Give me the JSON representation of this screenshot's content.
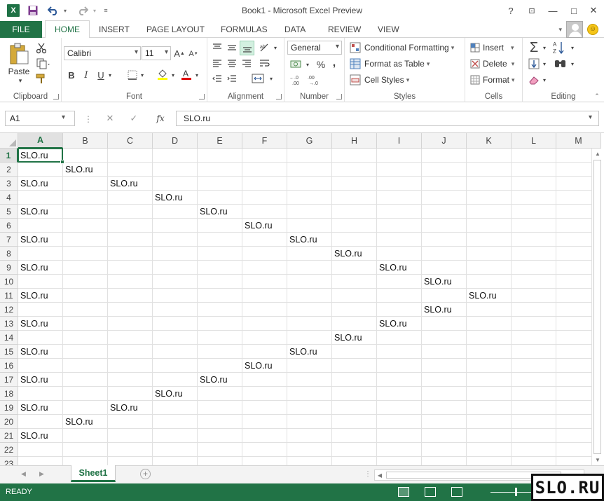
{
  "window": {
    "title": "Book1 - Microsoft Excel Preview",
    "app_icon": "X",
    "minimize": "—",
    "restore": "❐",
    "maximize": "□",
    "close": "✕",
    "help": "?"
  },
  "quick_access": {
    "save_icon": "save-icon",
    "undo_icon": "undo-icon",
    "redo_icon": "redo-icon"
  },
  "tabs": {
    "file": "FILE",
    "items": [
      "HOME",
      "INSERT",
      "PAGE LAYOUT",
      "FORMULAS",
      "DATA",
      "REVIEW",
      "VIEW"
    ],
    "active": "HOME"
  },
  "ribbon": {
    "clipboard": {
      "label": "Clipboard",
      "paste": "Paste"
    },
    "font": {
      "label": "Font",
      "font_name": "Calibri",
      "font_size": "11",
      "bold": "B",
      "italic": "I",
      "underline": "U",
      "grow": "A",
      "shrink": "A"
    },
    "alignment": {
      "label": "Alignment"
    },
    "number": {
      "label": "Number",
      "format": "General",
      "percent": "%",
      "comma": ","
    },
    "styles": {
      "label": "Styles",
      "conditional": "Conditional Formatting",
      "format_table": "Format as Table",
      "cell_styles": "Cell Styles"
    },
    "cells": {
      "label": "Cells",
      "insert": "Insert",
      "delete": "Delete",
      "format": "Format"
    },
    "editing": {
      "label": "Editing",
      "sum": "Σ"
    }
  },
  "formula_bar": {
    "name_box": "A1",
    "fx": "fx",
    "cancel": "✕",
    "enter": "✓",
    "value": "SLO.ru"
  },
  "grid": {
    "columns": [
      "A",
      "B",
      "C",
      "D",
      "E",
      "F",
      "G",
      "H",
      "I",
      "J",
      "K",
      "L",
      "M"
    ],
    "rows": [
      "1",
      "2",
      "3",
      "4",
      "5",
      "6",
      "7",
      "8",
      "9",
      "10",
      "11",
      "12",
      "13",
      "14",
      "15",
      "16",
      "17",
      "18",
      "19",
      "20",
      "21",
      "22",
      "23"
    ],
    "selected_cell": "A1",
    "cells": [
      {
        "ref": "A1",
        "value": "SLO.ru"
      },
      {
        "ref": "B2",
        "value": "SLO.ru"
      },
      {
        "ref": "A3",
        "value": "SLO.ru"
      },
      {
        "ref": "C3",
        "value": "SLO.ru"
      },
      {
        "ref": "D4",
        "value": "SLO.ru"
      },
      {
        "ref": "A5",
        "value": "SLO.ru"
      },
      {
        "ref": "E5",
        "value": "SLO.ru"
      },
      {
        "ref": "F6",
        "value": "SLO.ru"
      },
      {
        "ref": "A7",
        "value": "SLO.ru"
      },
      {
        "ref": "G7",
        "value": "SLO.ru"
      },
      {
        "ref": "H8",
        "value": "SLO.ru"
      },
      {
        "ref": "A9",
        "value": "SLO.ru"
      },
      {
        "ref": "I9",
        "value": "SLO.ru"
      },
      {
        "ref": "J10",
        "value": "SLO.ru"
      },
      {
        "ref": "A11",
        "value": "SLO.ru"
      },
      {
        "ref": "K11",
        "value": "SLO.ru"
      },
      {
        "ref": "J12",
        "value": "SLO.ru"
      },
      {
        "ref": "A13",
        "value": "SLO.ru"
      },
      {
        "ref": "I13",
        "value": "SLO.ru"
      },
      {
        "ref": "H14",
        "value": "SLO.ru"
      },
      {
        "ref": "A15",
        "value": "SLO.ru"
      },
      {
        "ref": "G15",
        "value": "SLO.ru"
      },
      {
        "ref": "F16",
        "value": "SLO.ru"
      },
      {
        "ref": "A17",
        "value": "SLO.ru"
      },
      {
        "ref": "E17",
        "value": "SLO.ru"
      },
      {
        "ref": "D18",
        "value": "SLO.ru"
      },
      {
        "ref": "A19",
        "value": "SLO.ru"
      },
      {
        "ref": "C19",
        "value": "SLO.ru"
      },
      {
        "ref": "B20",
        "value": "SLO.ru"
      },
      {
        "ref": "A21",
        "value": "SLO.ru"
      }
    ]
  },
  "sheets": {
    "tabs": [
      "Sheet1"
    ],
    "active": "Sheet1",
    "add": "+"
  },
  "status": {
    "text": "READY"
  },
  "watermark": "SLO.RU",
  "colors": {
    "accent": "#217346",
    "grid_line": "#e1e1e1",
    "header_bg": "#f3f3f3"
  }
}
